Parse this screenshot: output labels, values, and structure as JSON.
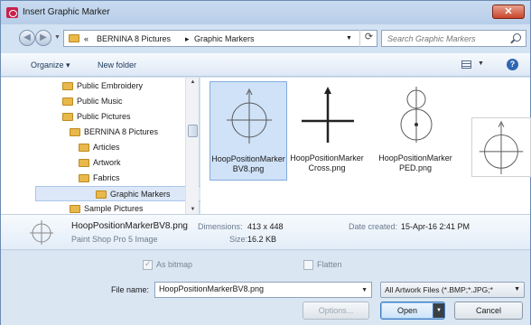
{
  "window": {
    "title": "Insert Graphic Marker",
    "close_label": "✕"
  },
  "address": {
    "overflow": "«",
    "crumbs": [
      "BERNINA 8 Pictures",
      "Graphic Markers"
    ],
    "separator": "▸",
    "refresh_icon": "refresh-icon",
    "search_placeholder": "Search Graphic Markers"
  },
  "toolbar": {
    "organize": "Organize ▾",
    "new_folder": "New folder"
  },
  "tree": [
    {
      "label": "Public Embroidery",
      "indent": 0,
      "selected": false
    },
    {
      "label": "Public Music",
      "indent": 0,
      "selected": false
    },
    {
      "label": "Public Pictures",
      "indent": 0,
      "selected": false
    },
    {
      "label": "BERNINA 8 Pictures",
      "indent": 1,
      "selected": false
    },
    {
      "label": "Articles",
      "indent": 2,
      "selected": false
    },
    {
      "label": "Artwork",
      "indent": 2,
      "selected": false
    },
    {
      "label": "Fabrics",
      "indent": 2,
      "selected": false
    },
    {
      "label": "Graphic Markers",
      "indent": 2,
      "selected": true
    },
    {
      "label": "Sample Pictures",
      "indent": 1,
      "selected": false
    }
  ],
  "files": [
    {
      "name": "HoopPositionMarkerBV8.png",
      "kind": "circle-arrow",
      "selected": true
    },
    {
      "name": "HoopPositionMarkerCross.png",
      "kind": "cross",
      "selected": false
    },
    {
      "name": "HoopPositionMarkerPED.png",
      "kind": "ped",
      "selected": false
    },
    {
      "name": "",
      "kind": "circle-arrow",
      "selected": false
    }
  ],
  "details": {
    "name": "HoopPositionMarkerBV8.png",
    "type": "Paint Shop Pro 5 Image",
    "dimensions_key": "Dimensions:",
    "dimensions_val": "413 x 448",
    "size_key": "Size:",
    "size_val": "16.2 KB",
    "created_key": "Date created:",
    "created_val": "15-Apr-16 2:41 PM"
  },
  "options": {
    "as_bitmap": "As bitmap",
    "flatten": "Flatten"
  },
  "form": {
    "file_name_label": "File name:",
    "file_name_value": "HoopPositionMarkerBV8.png",
    "filter": "All Artwork Files (*.BMP;*.JPG;*"
  },
  "buttons": {
    "options": "Options...",
    "open": "Open",
    "cancel": "Cancel"
  }
}
